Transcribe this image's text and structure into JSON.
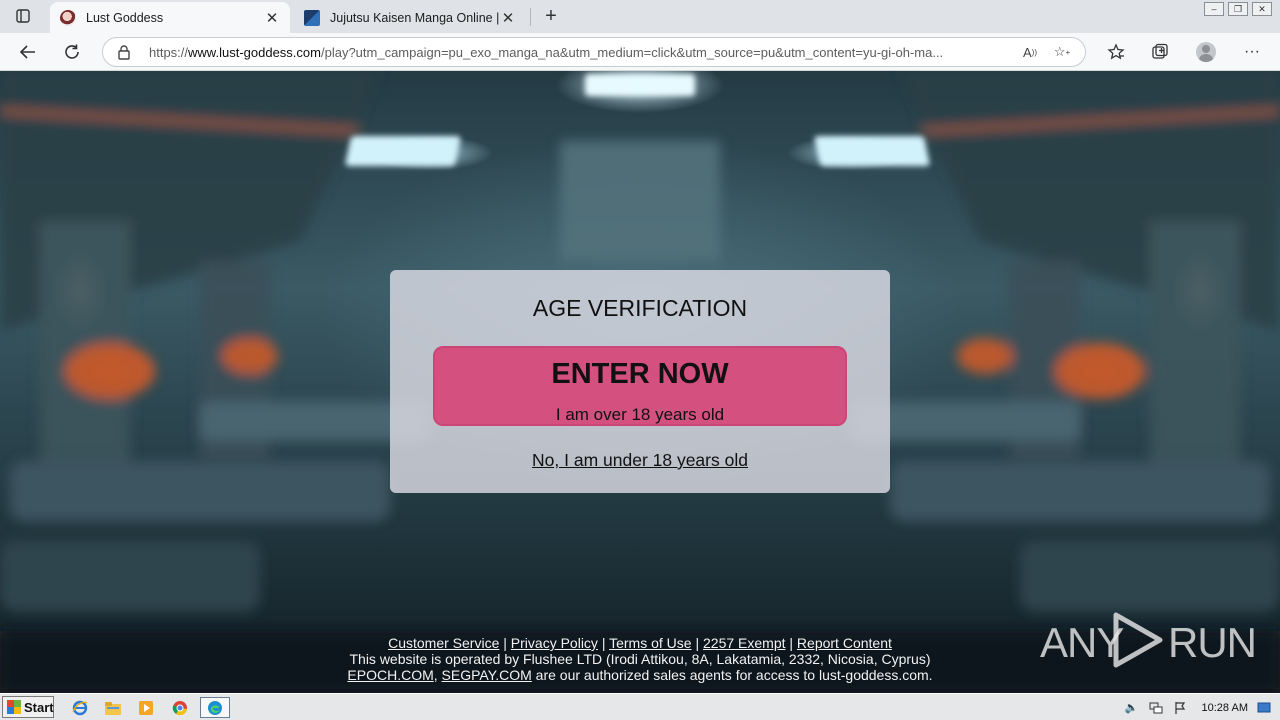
{
  "browser": {
    "tabs": [
      {
        "title": "Lust Goddess",
        "active": true,
        "favicon": "lust-goddess-favicon"
      },
      {
        "title": "Jujutsu Kaisen Manga Online | E",
        "active": false,
        "favicon": "manga-site-favicon"
      }
    ],
    "url": {
      "scheme": "https://",
      "host": "www.lust-goddess.com",
      "path": "/play?utm_campaign=pu_exo_manga_na&utm_medium=click&utm_source=pu&utm_content=yu-gi-oh-ma..."
    },
    "icons": {
      "back": "back-arrow-icon",
      "refresh": "refresh-icon",
      "lock": "lock-icon",
      "read_aloud": "read-aloud-icon",
      "add_favorite": "add-favorite-icon",
      "favorites": "favorites-icon",
      "collections": "collections-icon",
      "profile": "profile-avatar-icon",
      "menu": "more-menu-icon"
    }
  },
  "dialog": {
    "title": "AGE VERIFICATION",
    "enter_label": "ENTER NOW",
    "enter_sublabel": "I am over 18 years old",
    "under_label": "No, I am under 18 years old",
    "accent_color": "#d4507e"
  },
  "footer": {
    "links": [
      "Customer Service",
      "Privacy Policy",
      "Terms of Use",
      "2257 Exempt",
      "Report Content"
    ],
    "operator_text": "This website is operated by Flushee LTD (Irodi Attikou, 8A, Lakatamia, 2332, Nicosia, Cyprus)",
    "agent_link_1": "EPOCH.COM",
    "agent_sep": ", ",
    "agent_link_2": "SEGPAY.COM",
    "agent_text": " are our authorized sales agents for access to lust-goddess.com."
  },
  "watermark": {
    "left": "ANY",
    "right": "RUN"
  },
  "taskbar": {
    "start_label": "Start",
    "apps": [
      "internet-explorer-icon",
      "file-explorer-icon",
      "media-player-icon",
      "chrome-icon",
      "edge-icon"
    ],
    "clock": "10:28 AM"
  }
}
